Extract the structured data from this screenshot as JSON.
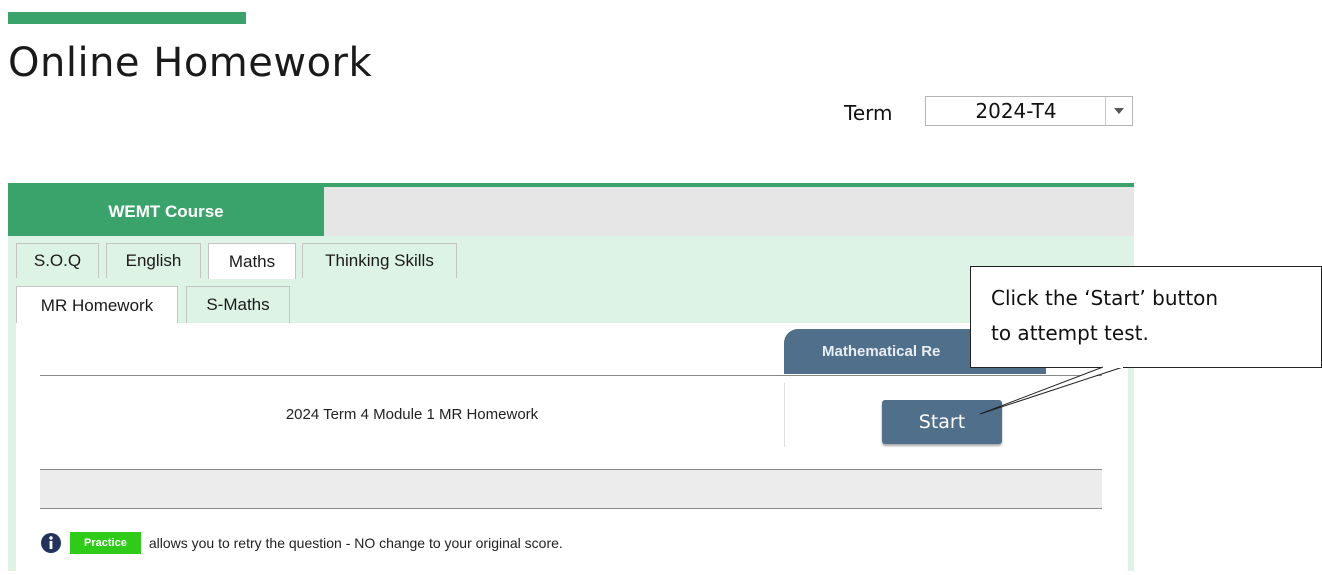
{
  "page": {
    "title": "Online Homework"
  },
  "term": {
    "label": "Term",
    "selected": "2024-T4"
  },
  "course": {
    "tab_label": "WEMT Course"
  },
  "subject_tabs": [
    {
      "label": "S.O.Q"
    },
    {
      "label": "English"
    },
    {
      "label": "Maths",
      "active": true
    },
    {
      "label": "Thinking Skills"
    }
  ],
  "sub_tabs": [
    {
      "label": "MR Homework",
      "active": true
    },
    {
      "label": "S-Maths"
    }
  ],
  "test_table": {
    "column_header": "Mathematical Re",
    "rows": [
      {
        "title": "2024 Term 4 Module 1 MR Homework",
        "action_label": "Start"
      }
    ]
  },
  "info": {
    "badge_label": "Practice",
    "text": "allows you to retry the question - NO change to your original score."
  },
  "callout": {
    "line1": "Click the ‘Start’ button",
    "line2": "to attempt test."
  },
  "colors": {
    "brand_green": "#3aa36b",
    "panel_bg": "#ddf3e6",
    "button_blue": "#4f6f8a",
    "practice_green": "#2ecc18"
  }
}
